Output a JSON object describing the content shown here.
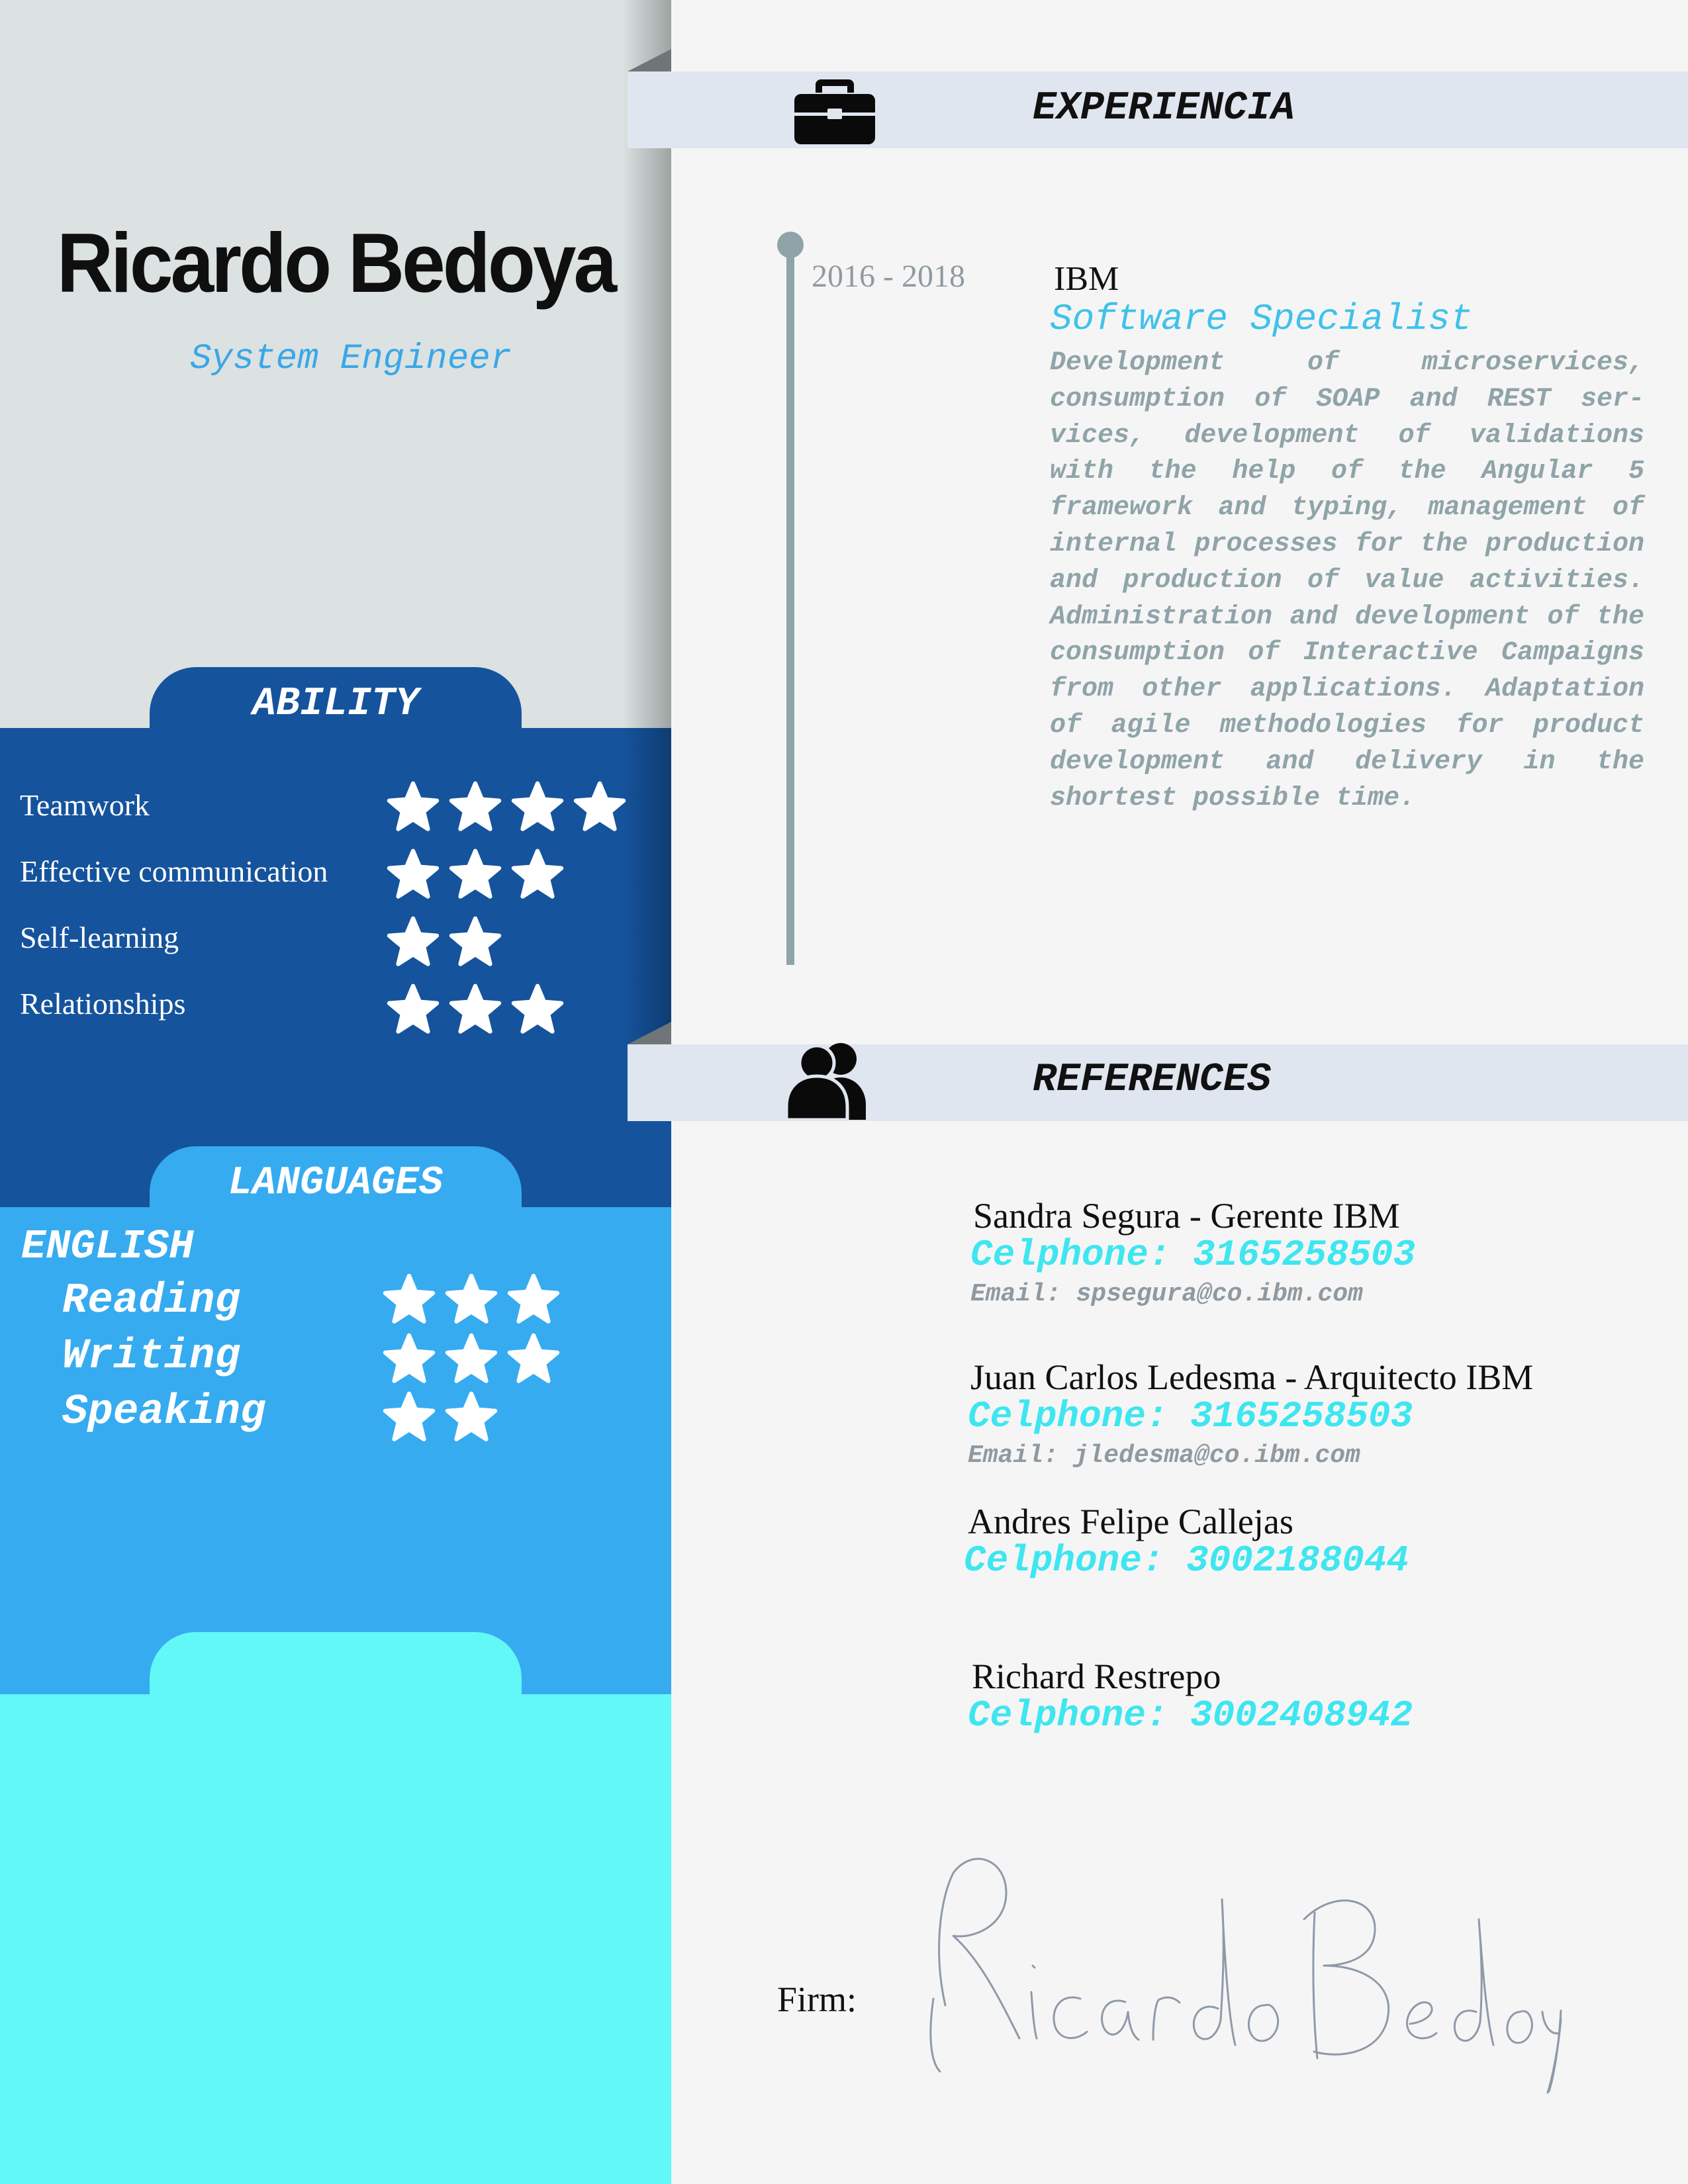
{
  "profile": {
    "name": "Ricardo Bedoya",
    "role": "System Engineer"
  },
  "ability": {
    "title": "ABILITY",
    "items": [
      {
        "label": "Teamwork",
        "stars": 4
      },
      {
        "label": "Effective communication",
        "stars": 3
      },
      {
        "label": "Self-learning",
        "stars": 2
      },
      {
        "label": "Relationships",
        "stars": 3
      }
    ]
  },
  "languages": {
    "title": "LANGUAGES",
    "language": "ENGLISH",
    "items": [
      {
        "label": "Reading",
        "stars": 3
      },
      {
        "label": "Writing",
        "stars": 3
      },
      {
        "label": "Speaking",
        "stars": 2
      }
    ]
  },
  "experience": {
    "title": "EXPERIENCIA",
    "icon": "briefcase-icon",
    "years": "2016 - 2018",
    "company": "IBM",
    "position": "Software Specialist",
    "description": "Development of microservices, consumption of SOAP and REST ser­vices, development of validations with the help of the Angular 5 framework and typing, management of internal processes for the production and production of value activities. Administration and development of the consump­tion of Interactive Campaigns from other applications. Adaptation of agile methodologies for product development and de­livery in the shortest possible time."
  },
  "references": {
    "title": "REFERENCES",
    "icon": "people-icon",
    "items": [
      {
        "name": "Sandra Segura - Gerente IBM",
        "phone": "Celphone: 3165258503",
        "email": "Email: spsegura@co.ibm.com"
      },
      {
        "name": "Juan Carlos Ledesma - Arquitecto IBM",
        "phone": "Celphone: 3165258503",
        "email": "Email: jledesma@co.ibm.com"
      },
      {
        "name": "Andres Felipe Callejas",
        "phone": "Celphone: 3002188044"
      },
      {
        "name": "Richard Restrepo",
        "phone": "Celphone: 3002408942"
      }
    ]
  },
  "signature": {
    "label": "Firm:",
    "text": "Ricardo Bedoya"
  },
  "colors": {
    "ability_panel": "#15539c",
    "languages_panel": "#36abf0",
    "bottom_panel": "#61f8f7",
    "accent_title": "#3ec2ea",
    "phone": "#3ee6f0"
  }
}
